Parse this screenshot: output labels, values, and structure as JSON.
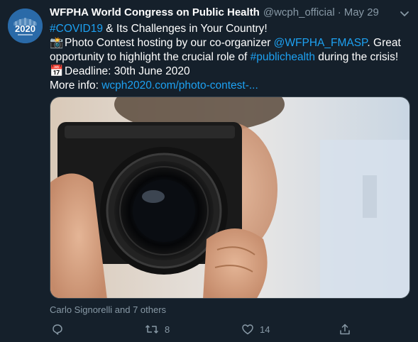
{
  "tweet": {
    "author_name": "WFPHA World Congress on Public Health",
    "author_handle": "@wcph_official",
    "separator": "·",
    "date": "May 29",
    "avatar_text": "2020",
    "lines": {
      "l1_hashtag": "#COVID19",
      "l1_text": " & Its Challenges in Your Country!",
      "l2_emoji": "📸",
      "l2_text": "Photo Contest hosting by our co-organizer ",
      "l2_mention": "@WFPHA_FMASP",
      "l2_tail": ". Great",
      "l3_text": "opportunity to highlight the crucial role of ",
      "l3_hashtag": "#publichealth",
      "l3_tail": " during the crisis!",
      "l4_emoji": "📅",
      "l4_text": "Deadline: 30th June 2020",
      "l5_text": "More info: ",
      "l5_link": "wcph2020.com/photo-contest-..."
    },
    "likers": "Carlo Signorelli and 7 others",
    "actions": {
      "reply_icon": "reply-icon",
      "retweet_icon": "retweet-icon",
      "retweet_count": "8",
      "like_icon": "heart-icon",
      "like_count": "14",
      "share_icon": "share-icon"
    },
    "colors": {
      "background": "#15202b",
      "link": "#1da1f2",
      "muted": "#8899a6"
    }
  }
}
